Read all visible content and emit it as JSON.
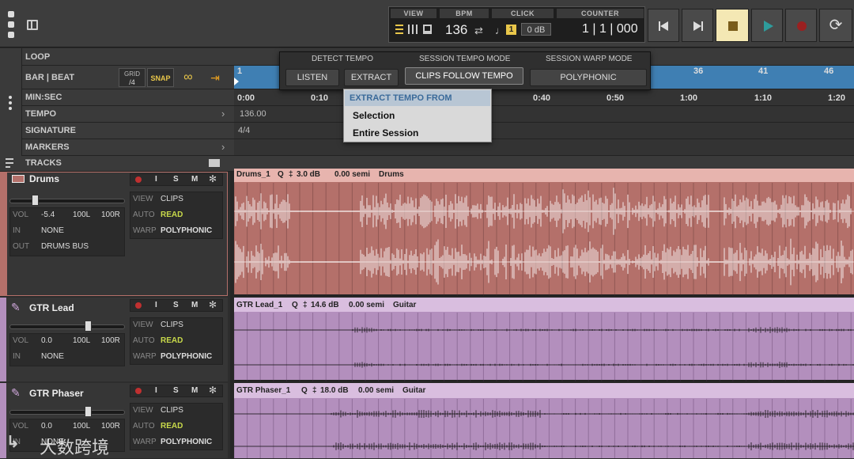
{
  "transport": {
    "view_label": "VIEW",
    "bpm_label": "BPM",
    "bpm_value": "136",
    "click_label": "CLICK",
    "click_db": "0 dB",
    "click_badge": "1",
    "counter_label": "COUNTER",
    "counter_value": "1 | 1 | 000"
  },
  "rows": {
    "loop": "LOOP",
    "bar_beat": "BAR | BEAT",
    "grid_label": "GRID",
    "grid_value": "/4",
    "snap_label": "SNAP",
    "min_sec": "MIN:SEC",
    "tempo": "TEMPO",
    "tempo_value": "136.00",
    "signature": "SIGNATURE",
    "signature_value": "4/4",
    "markers": "MARKERS",
    "tracks": "TRACKS"
  },
  "bar_ticks": [
    {
      "label": "1"
    },
    {
      "label": "36"
    },
    {
      "label": "41"
    },
    {
      "label": "46"
    }
  ],
  "time_ticks": [
    "0:00",
    "0:10",
    "0:40",
    "0:50",
    "1:00",
    "1:10",
    "1:20"
  ],
  "tempo_panel": {
    "detect_tempo": "DETECT TEMPO",
    "session_tempo_mode": "SESSION TEMPO MODE",
    "session_warp_mode": "SESSION WARP MODE",
    "listen_btn": "LISTEN",
    "extract_btn": "EXTRACT",
    "clips_follow_btn": "CLIPS FOLLOW TEMPO",
    "warp_value": "POLYPHONIC"
  },
  "extract_menu": {
    "header": "EXTRACT TEMPO FROM",
    "items": [
      "Selection",
      "Entire Session"
    ]
  },
  "tracks": [
    {
      "name": "Drums",
      "vol_label": "VOL",
      "vol": "-5.4",
      "pan_l": "100L",
      "pan_r": "100R",
      "in_label": "IN",
      "in": "NONE",
      "out_label": "OUT",
      "out": "DRUMS BUS",
      "view_label": "VIEW",
      "view": "CLIPS",
      "auto_label": "AUTO",
      "auto": "READ",
      "warp_label": "WARP",
      "warp": "POLYPHONIC",
      "clip_name": "Drums_1",
      "clip_q": "Q",
      "clip_gain": "3.0 dB",
      "clip_semi": "0.00 semi",
      "clip_tag": "Drums",
      "fader": 0.22,
      "color": "#b4706a"
    },
    {
      "name": "GTR Lead",
      "vol_label": "VOL",
      "vol": "0.0",
      "pan_l": "100L",
      "pan_r": "100R",
      "in_label": "IN",
      "in": "NONE",
      "view_label": "VIEW",
      "view": "CLIPS",
      "auto_label": "AUTO",
      "auto": "READ",
      "warp_label": "WARP",
      "warp": "POLYPHONIC",
      "clip_name": "GTR Lead_1",
      "clip_q": "Q",
      "clip_gain": "14.6 dB",
      "clip_semi": "0.00 semi",
      "clip_tag": "Guitar",
      "fader": 0.68,
      "color": "#b38fbd"
    },
    {
      "name": "GTR Phaser",
      "vol_label": "VOL",
      "vol": "0.0",
      "pan_l": "100L",
      "pan_r": "100R",
      "in_label": "IN",
      "in": "NONE",
      "view_label": "VIEW",
      "view": "CLIPS",
      "auto_label": "AUTO",
      "auto": "READ",
      "warp_label": "WARP",
      "warp": "POLYPHONIC",
      "clip_name": "GTR Phaser_1",
      "clip_q": "Q",
      "clip_gain": "18.0 dB",
      "clip_semi": "0.00 semi",
      "clip_tag": "Guitar",
      "fader": 0.68,
      "color": "#b38fbd"
    }
  ],
  "msi_labels": {
    "i": "I",
    "s": "S",
    "m": "M"
  },
  "watermark": "大数跨境",
  "colors": {
    "accent": "#e8c64a",
    "read": "#c8d94a",
    "ruler_blue": "#3f7fb3"
  }
}
